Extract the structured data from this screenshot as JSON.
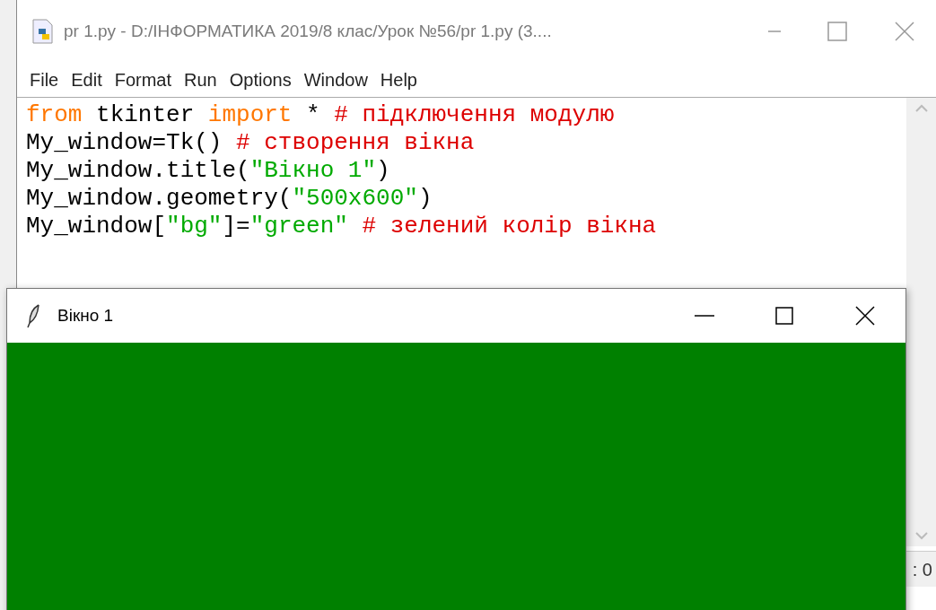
{
  "editor_window": {
    "title": "pr 1.py - D:/ІНФОРМАТИКА 2019/8 клас/Урок №56/pr 1.py (3....",
    "menu": [
      "File",
      "Edit",
      "Format",
      "Run",
      "Options",
      "Window",
      "Help"
    ],
    "code_lines": [
      [
        {
          "kind": "keyword",
          "text": "from"
        },
        {
          "kind": "plain",
          "text": " tkinter "
        },
        {
          "kind": "keyword",
          "text": "import"
        },
        {
          "kind": "plain",
          "text": " * "
        },
        {
          "kind": "comment",
          "text": "# підключення модулю"
        }
      ],
      [
        {
          "kind": "plain",
          "text": "My_window=Tk() "
        },
        {
          "kind": "comment",
          "text": "# створення вікна"
        }
      ],
      [
        {
          "kind": "plain",
          "text": "My_window.title("
        },
        {
          "kind": "string",
          "text": "\"Вікно 1\""
        },
        {
          "kind": "plain",
          "text": ")"
        }
      ],
      [
        {
          "kind": "plain",
          "text": "My_window.geometry("
        },
        {
          "kind": "string",
          "text": "\"500x600\""
        },
        {
          "kind": "plain",
          "text": ")"
        }
      ],
      [
        {
          "kind": "plain",
          "text": "My_window["
        },
        {
          "kind": "string",
          "text": "\"bg\""
        },
        {
          "kind": "plain",
          "text": "]="
        },
        {
          "kind": "string",
          "text": "\"green\" "
        },
        {
          "kind": "comment",
          "text": "# зелений колір вікна"
        }
      ]
    ],
    "status": ": 0"
  },
  "tk_window": {
    "title": "Вікно 1"
  }
}
